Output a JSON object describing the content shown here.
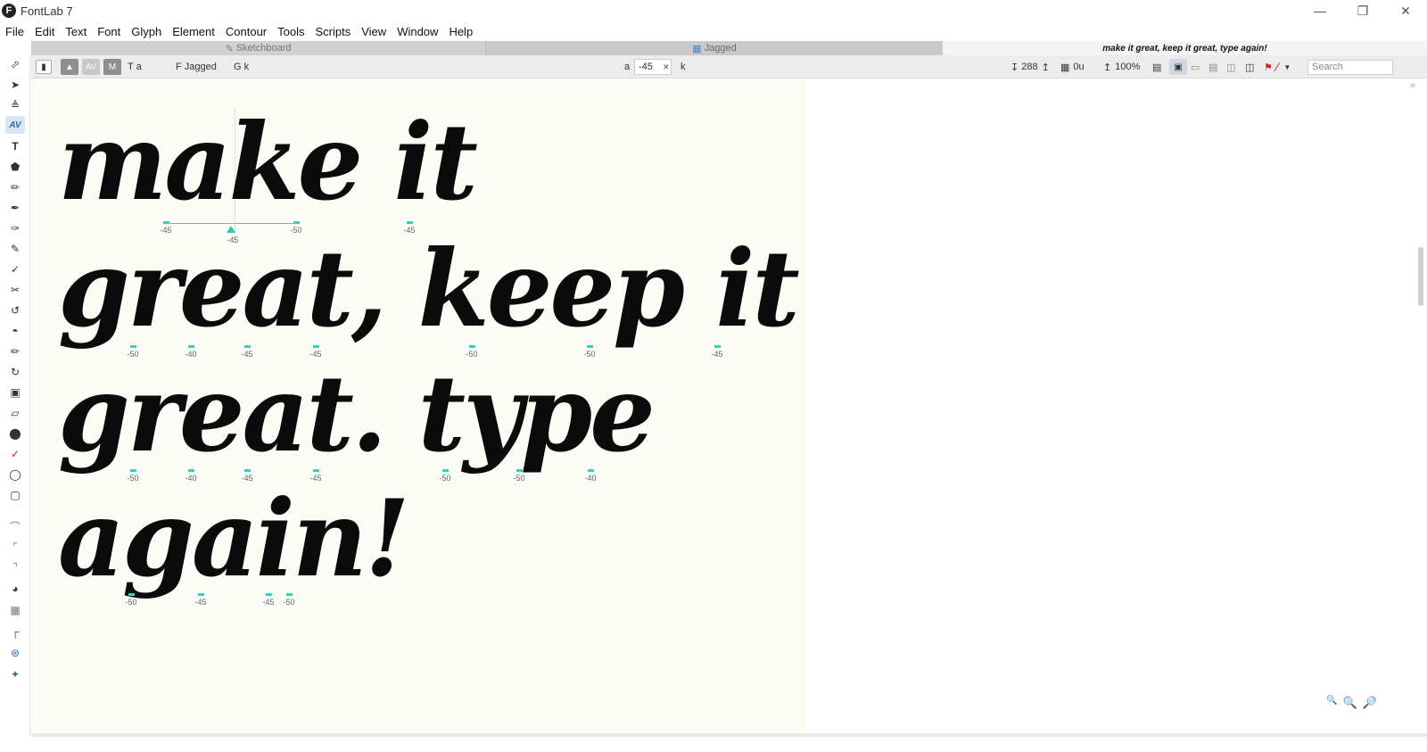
{
  "window": {
    "title": "FontLab 7",
    "logo_letter": "F",
    "controls": {
      "minimize": "—",
      "maximize": "❐",
      "close": "✕"
    }
  },
  "menu": [
    "File",
    "Edit",
    "Text",
    "Font",
    "Glyph",
    "Element",
    "Contour",
    "Tools",
    "Scripts",
    "View",
    "Window",
    "Help"
  ],
  "tabs": {
    "sketchboard": "Sketchboard",
    "jagged": "Jagged",
    "text": "make it great, keep it great, type again!"
  },
  "optionsbar": {
    "text_mode": "T a",
    "font_label": "F Jagged",
    "glyph_label": "G k",
    "btn_av": "AV",
    "btn_m": "M",
    "left_glyph": "a",
    "kern_value": "-45",
    "right_glyph": "k",
    "font_size": "288",
    "tracking": "0u",
    "zoom": "100%",
    "search_placeholder": "Search"
  },
  "canvas": {
    "lines": [
      "make it",
      "great, keep it",
      "great. type",
      "again!"
    ],
    "kern_row1": [
      "-45",
      "-50",
      "-45"
    ],
    "cursor_kern": "-45",
    "kern_row2": [
      "-50",
      "-40",
      "-45",
      "-45",
      "-50",
      "-50",
      "-45"
    ],
    "kern_row3": [
      "-50",
      "-40",
      "-45",
      "-45",
      "-50",
      "-50",
      "-40"
    ],
    "kern_row4": [
      "-50",
      "-45",
      "-45",
      "-50"
    ]
  },
  "tools": [
    "pointer-icon",
    "contour-pointer-icon",
    "metrics-icon",
    "kerning-icon",
    "text-icon",
    "eraser-icon",
    "brush-icon",
    "pen-icon",
    "rapid-pen-icon",
    "pencil-icon",
    "knife-icon",
    "scissors-icon",
    "spiral-icon",
    "fill-icon",
    "ruler-icon",
    "rotate-icon",
    "scale-icon",
    "slant-icon",
    "blob-icon",
    "eyedropper-icon",
    "ellipse-icon",
    "rectangle-icon",
    "curve-icon",
    "node-icon",
    "corner-icon",
    "magnet-icon",
    "grid-icon",
    "anchor-icon",
    "guide-icon",
    "tag-icon"
  ],
  "colors": {
    "accent": "#34d1bf",
    "canvas_bg": "#fbfcf5",
    "glyph": "#0b0b0b"
  }
}
